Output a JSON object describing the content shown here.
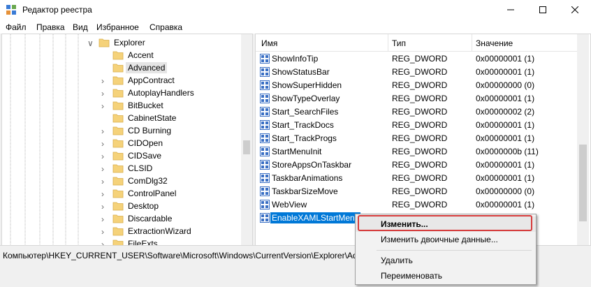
{
  "window": {
    "title": "Редактор реестра"
  },
  "menu": [
    "Файл",
    "Правка",
    "Вид",
    "Избранное",
    "Справка"
  ],
  "tree": {
    "items": [
      {
        "label": "Explorer",
        "expanded": true,
        "has_children": true
      },
      {
        "label": "Accent",
        "has_children": false
      },
      {
        "label": "Advanced",
        "selected": true,
        "has_children": false
      },
      {
        "label": "AppContract",
        "has_children": true
      },
      {
        "label": "AutoplayHandlers",
        "has_children": true
      },
      {
        "label": "BitBucket",
        "has_children": true
      },
      {
        "label": "CabinetState",
        "has_children": false
      },
      {
        "label": "CD Burning",
        "has_children": true
      },
      {
        "label": "CIDOpen",
        "has_children": true
      },
      {
        "label": "CIDSave",
        "has_children": true
      },
      {
        "label": "CLSID",
        "has_children": true
      },
      {
        "label": "ComDlg32",
        "has_children": true
      },
      {
        "label": "ControlPanel",
        "has_children": true
      },
      {
        "label": "Desktop",
        "has_children": true
      },
      {
        "label": "Discardable",
        "has_children": true
      },
      {
        "label": "ExtractionWizard",
        "has_children": true
      },
      {
        "label": "FileExts",
        "has_children": true
      }
    ]
  },
  "list": {
    "columns": {
      "name": "Имя",
      "type": "Тип",
      "value": "Значение"
    },
    "rows": [
      {
        "name": "ShowInfoTip",
        "type": "REG_DWORD",
        "value": "0x00000001 (1)"
      },
      {
        "name": "ShowStatusBar",
        "type": "REG_DWORD",
        "value": "0x00000001 (1)"
      },
      {
        "name": "ShowSuperHidden",
        "type": "REG_DWORD",
        "value": "0x00000000 (0)"
      },
      {
        "name": "ShowTypeOverlay",
        "type": "REG_DWORD",
        "value": "0x00000001 (1)"
      },
      {
        "name": "Start_SearchFiles",
        "type": "REG_DWORD",
        "value": "0x00000002 (2)"
      },
      {
        "name": "Start_TrackDocs",
        "type": "REG_DWORD",
        "value": "0x00000001 (1)"
      },
      {
        "name": "Start_TrackProgs",
        "type": "REG_DWORD",
        "value": "0x00000001 (1)"
      },
      {
        "name": "StartMenuInit",
        "type": "REG_DWORD",
        "value": "0x0000000b (11)"
      },
      {
        "name": "StoreAppsOnTaskbar",
        "type": "REG_DWORD",
        "value": "0x00000001 (1)"
      },
      {
        "name": "TaskbarAnimations",
        "type": "REG_DWORD",
        "value": "0x00000001 (1)"
      },
      {
        "name": "TaskbarSizeMove",
        "type": "REG_DWORD",
        "value": "0x00000000 (0)"
      },
      {
        "name": "WebView",
        "type": "REG_DWORD",
        "value": "0x00000001 (1)"
      },
      {
        "name": "EnableXAMLStartMenu",
        "type": "",
        "value": "",
        "editing": true
      }
    ]
  },
  "context_menu": {
    "items": [
      "Изменить...",
      "Изменить двоичные данные...",
      "Удалить",
      "Переименовать"
    ]
  },
  "status": {
    "path": "Компьютер\\HKEY_CURRENT_USER\\Software\\Microsoft\\Windows\\CurrentVersion\\Explorer\\Adva"
  },
  "colors": {
    "selection": "#0078d7",
    "highlight_border": "#d63b3b",
    "folder": "#f5d27a"
  }
}
